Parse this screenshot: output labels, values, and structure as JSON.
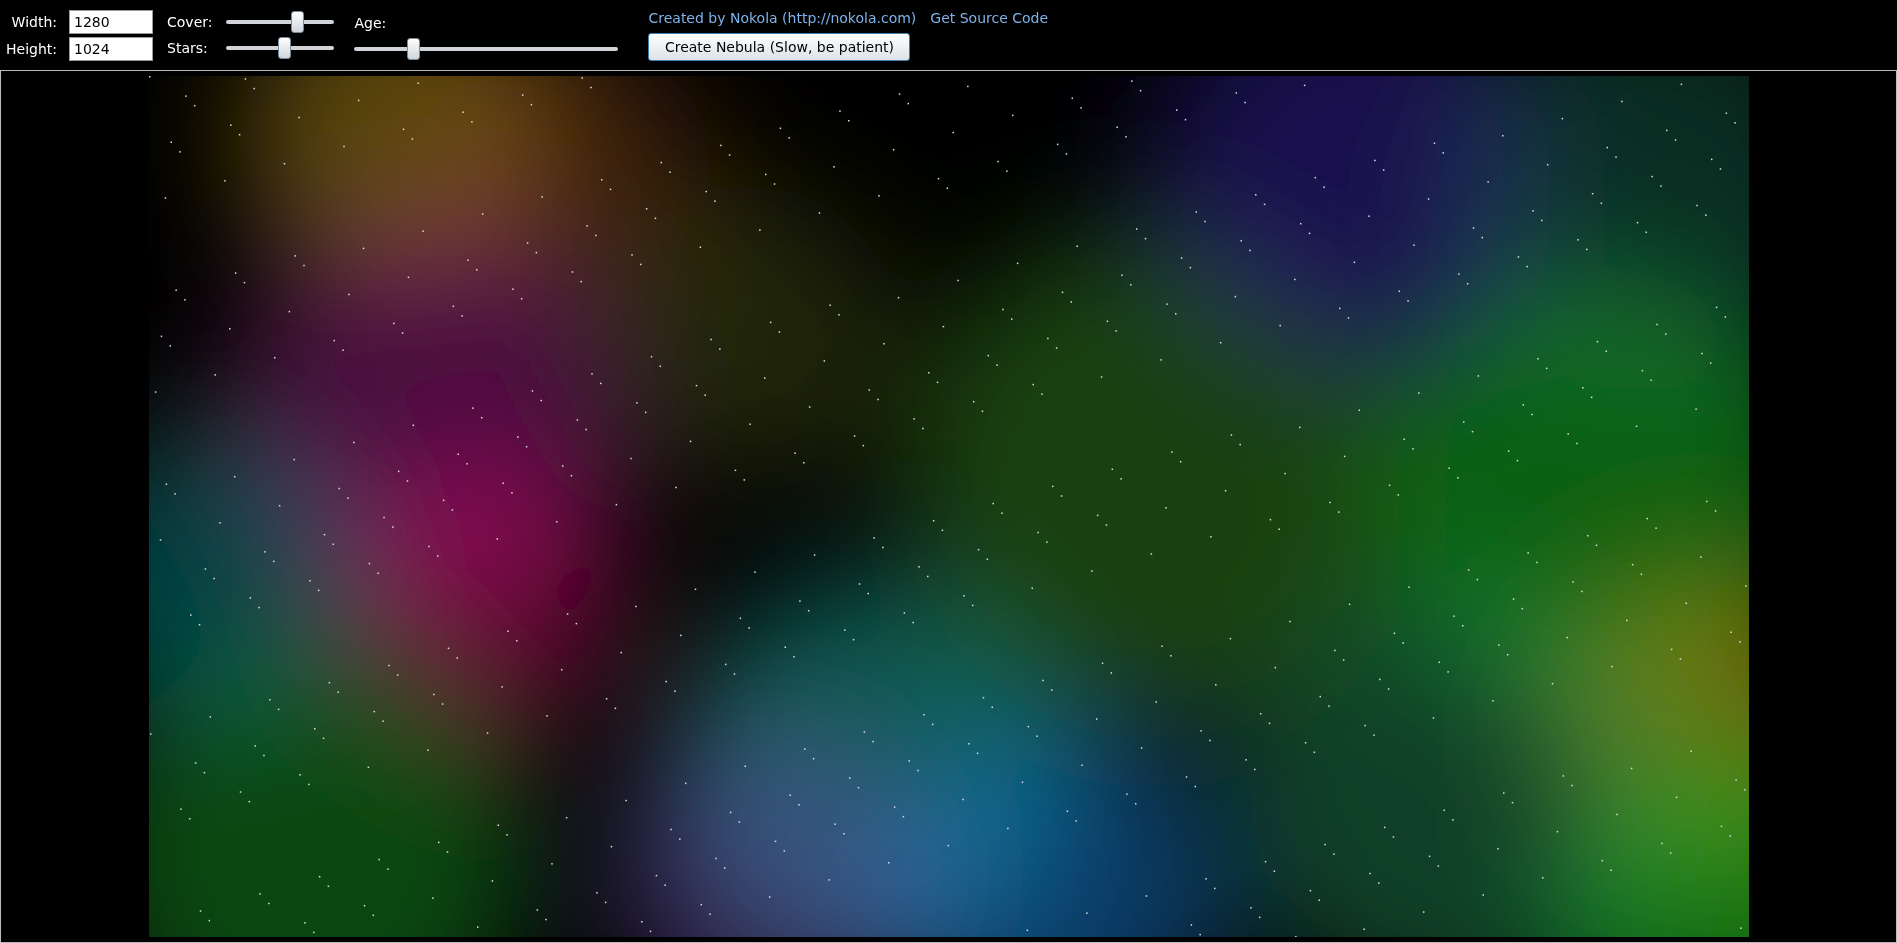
{
  "size_fields": [
    {
      "label": "Width:",
      "value": "1280"
    },
    {
      "label": "Height:",
      "value": "1024"
    }
  ],
  "sliders": [
    {
      "label": "Cover:",
      "level": 0.65
    },
    {
      "label": "Stars:",
      "level": 0.53
    }
  ],
  "age": {
    "label": "Age:",
    "level": 0.22
  },
  "links": [
    "Created by Nokola (http://nokola.com)",
    "Get Source Code"
  ],
  "create_button": "Create Nebula (Slow, be patient)"
}
